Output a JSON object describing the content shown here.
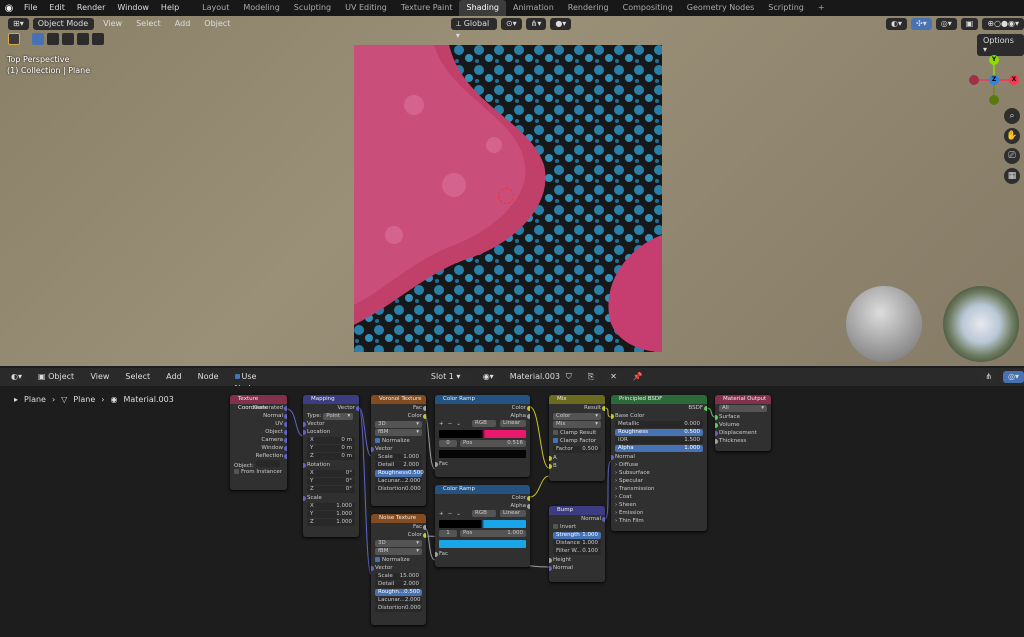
{
  "topbar": {
    "menus": [
      "File",
      "Edit",
      "Render",
      "Window",
      "Help"
    ],
    "workspaces": [
      "Layout",
      "Modeling",
      "Sculpting",
      "UV Editing",
      "Texture Paint",
      "Shading",
      "Animation",
      "Rendering",
      "Compositing",
      "Geometry Nodes",
      "Scripting"
    ],
    "active_workspace": "Shading",
    "add_tab": "+"
  },
  "viewport": {
    "mode": "Object Mode",
    "menus": [
      "View",
      "Select",
      "Add",
      "Object"
    ],
    "orientation": "Global",
    "options": "Options",
    "overlay_line1": "Top Perspective",
    "overlay_line2": "(1) Collection | Plane",
    "gizmo": {
      "x": "X",
      "y": "Y",
      "z": "Z"
    }
  },
  "node_header": {
    "mode": "Object",
    "menus": [
      "View",
      "Select",
      "Add",
      "Node"
    ],
    "use_nodes": "Use Nodes",
    "slot": "Slot 1",
    "material": "Material.003"
  },
  "breadcrumb": [
    "Plane",
    "Plane",
    "Material.003"
  ],
  "nodes": {
    "texcoord": {
      "title": "Texture Coordinate",
      "outputs": [
        "Generated",
        "Normal",
        "UV",
        "Object",
        "Camera",
        "Window",
        "Reflection"
      ],
      "object_label": "Object:",
      "from_instancer": "From Instancer"
    },
    "mapping": {
      "title": "Mapping",
      "out": "Vector",
      "type_label": "Type:",
      "type_value": "Point",
      "vector": "Vector",
      "location": "Location",
      "loc": [
        [
          "X",
          "0 m"
        ],
        [
          "Y",
          "0 m"
        ],
        [
          "Z",
          "0 m"
        ]
      ],
      "rotation": "Rotation",
      "rot": [
        [
          "X",
          "0°"
        ],
        [
          "Y",
          "0°"
        ],
        [
          "Z",
          "0°"
        ]
      ],
      "scale": "Scale",
      "scl": [
        [
          "X",
          "1.000"
        ],
        [
          "Y",
          "1.000"
        ],
        [
          "Z",
          "1.000"
        ]
      ]
    },
    "voronoi": {
      "title": "Voronoi Texture",
      "outs": [
        "Fac",
        "Color"
      ],
      "dim": "3D",
      "type": "fBM",
      "normalize": "Normalize",
      "vector": "Vector",
      "fields": [
        [
          "Scale",
          "1.000"
        ],
        [
          "Detail",
          "2.000"
        ],
        [
          "Roughness",
          "0.500"
        ],
        [
          "Lacunar...",
          "2.000"
        ],
        [
          "Distortion",
          "0.000"
        ]
      ]
    },
    "noise": {
      "title": "Noise Texture",
      "outs": [
        "Fac",
        "Color"
      ],
      "dim": "3D",
      "type": "fBM",
      "normalize": "Normalize",
      "vector": "Vector",
      "fields": [
        [
          "Scale",
          "15.000"
        ],
        [
          "Detail",
          "2.000"
        ],
        [
          "Roughn...",
          "0.500"
        ],
        [
          "Lacunar...",
          "2.000"
        ],
        [
          "Distortion",
          "0.000"
        ]
      ]
    },
    "ramp1": {
      "title": "Color Ramp",
      "outs": [
        "Color",
        "Alpha"
      ],
      "mode": "RGB",
      "interp": "Linear",
      "index": "0",
      "pos_label": "Pos",
      "pos": "0.516",
      "in": "Fac",
      "color_hex": "#e8196c"
    },
    "ramp2": {
      "title": "Color Ramp",
      "outs": [
        "Color",
        "Alpha"
      ],
      "mode": "RGB",
      "interp": "Linear",
      "index": "1",
      "pos_label": "Pos",
      "pos": "1.000",
      "in": "Fac",
      "color_hex": "#1aa5e8"
    },
    "mix": {
      "title": "Mix",
      "out": "Result",
      "type": "Color",
      "blend": "Mix",
      "clamp_result": "Clamp Result",
      "clamp_factor": "Clamp Factor",
      "factor_label": "Factor",
      "factor": "0.500",
      "a": "A",
      "b": "B"
    },
    "bump": {
      "title": "Bump",
      "out": "Normal",
      "invert": "Invert",
      "fields": [
        [
          "Strength",
          "1.000"
        ],
        [
          "Distance",
          "1.000"
        ],
        [
          "Filter W...",
          "0.100"
        ]
      ],
      "height": "Height",
      "normal": "Normal"
    },
    "bsdf": {
      "title": "Principled BSDF",
      "out": "BSDF",
      "base_color": "Base Color",
      "fields": [
        [
          "Metallic",
          "0.000"
        ],
        [
          "Roughness",
          "0.500"
        ],
        [
          "IOR",
          "1.500"
        ],
        [
          "Alpha",
          "1.000"
        ]
      ],
      "normal": "Normal",
      "panels": [
        "Diffuse",
        "Subsurface",
        "Specular",
        "Transmission",
        "Coat",
        "Sheen",
        "Emission",
        "Thin Film"
      ]
    },
    "output": {
      "title": "Material Output",
      "target": "All",
      "inputs": [
        "Surface",
        "Volume",
        "Displacement",
        "Thickness"
      ]
    }
  },
  "colors": {
    "pink": "#e8196c",
    "blue": "#1aa5e8",
    "accent": "#4772b3"
  }
}
